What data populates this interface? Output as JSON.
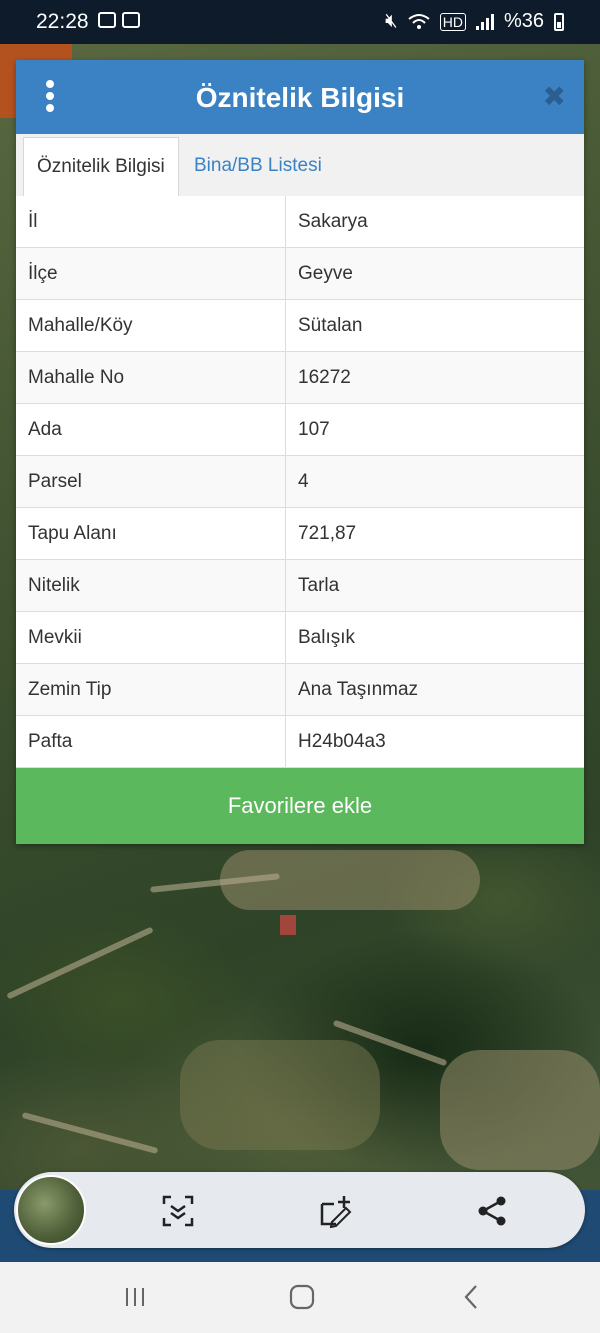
{
  "status_bar": {
    "time": "22:28",
    "battery": "%36",
    "icons": [
      "image-icon",
      "calendar-icon",
      "mute-icon",
      "wifi-icon",
      "hd-icon",
      "signal-icon",
      "battery-icon"
    ]
  },
  "dialog": {
    "title": "Öznitelik Bilgisi",
    "tabs": [
      {
        "label": "Öznitelik Bilgisi",
        "active": true
      },
      {
        "label": "Bina/BB Listesi",
        "active": false
      }
    ],
    "rows": [
      {
        "key": "İl",
        "value": "Sakarya"
      },
      {
        "key": "İlçe",
        "value": "Geyve"
      },
      {
        "key": "Mahalle/Köy",
        "value": "Sütalan"
      },
      {
        "key": "Mahalle No",
        "value": "16272"
      },
      {
        "key": "Ada",
        "value": "107"
      },
      {
        "key": "Parsel",
        "value": "4"
      },
      {
        "key": "Tapu Alanı",
        "value": "721,87"
      },
      {
        "key": "Nitelik",
        "value": "Tarla"
      },
      {
        "key": "Mevkii",
        "value": "Balışık"
      },
      {
        "key": "Zemin Tip",
        "value": "Ana Taşınmaz"
      },
      {
        "key": "Pafta",
        "value": "H24b04a3"
      }
    ],
    "favorite_button": "Favorilere ekle"
  },
  "colors": {
    "header": "#3b82c4",
    "favorite": "#5cb85c",
    "tab_link": "#3b82c4"
  },
  "toolbar": {
    "icons": [
      "map-thumbnail",
      "scan-icon",
      "edit-area-icon",
      "share-icon"
    ]
  },
  "navbar": {
    "icons": [
      "recents-icon",
      "home-icon",
      "back-icon"
    ]
  }
}
